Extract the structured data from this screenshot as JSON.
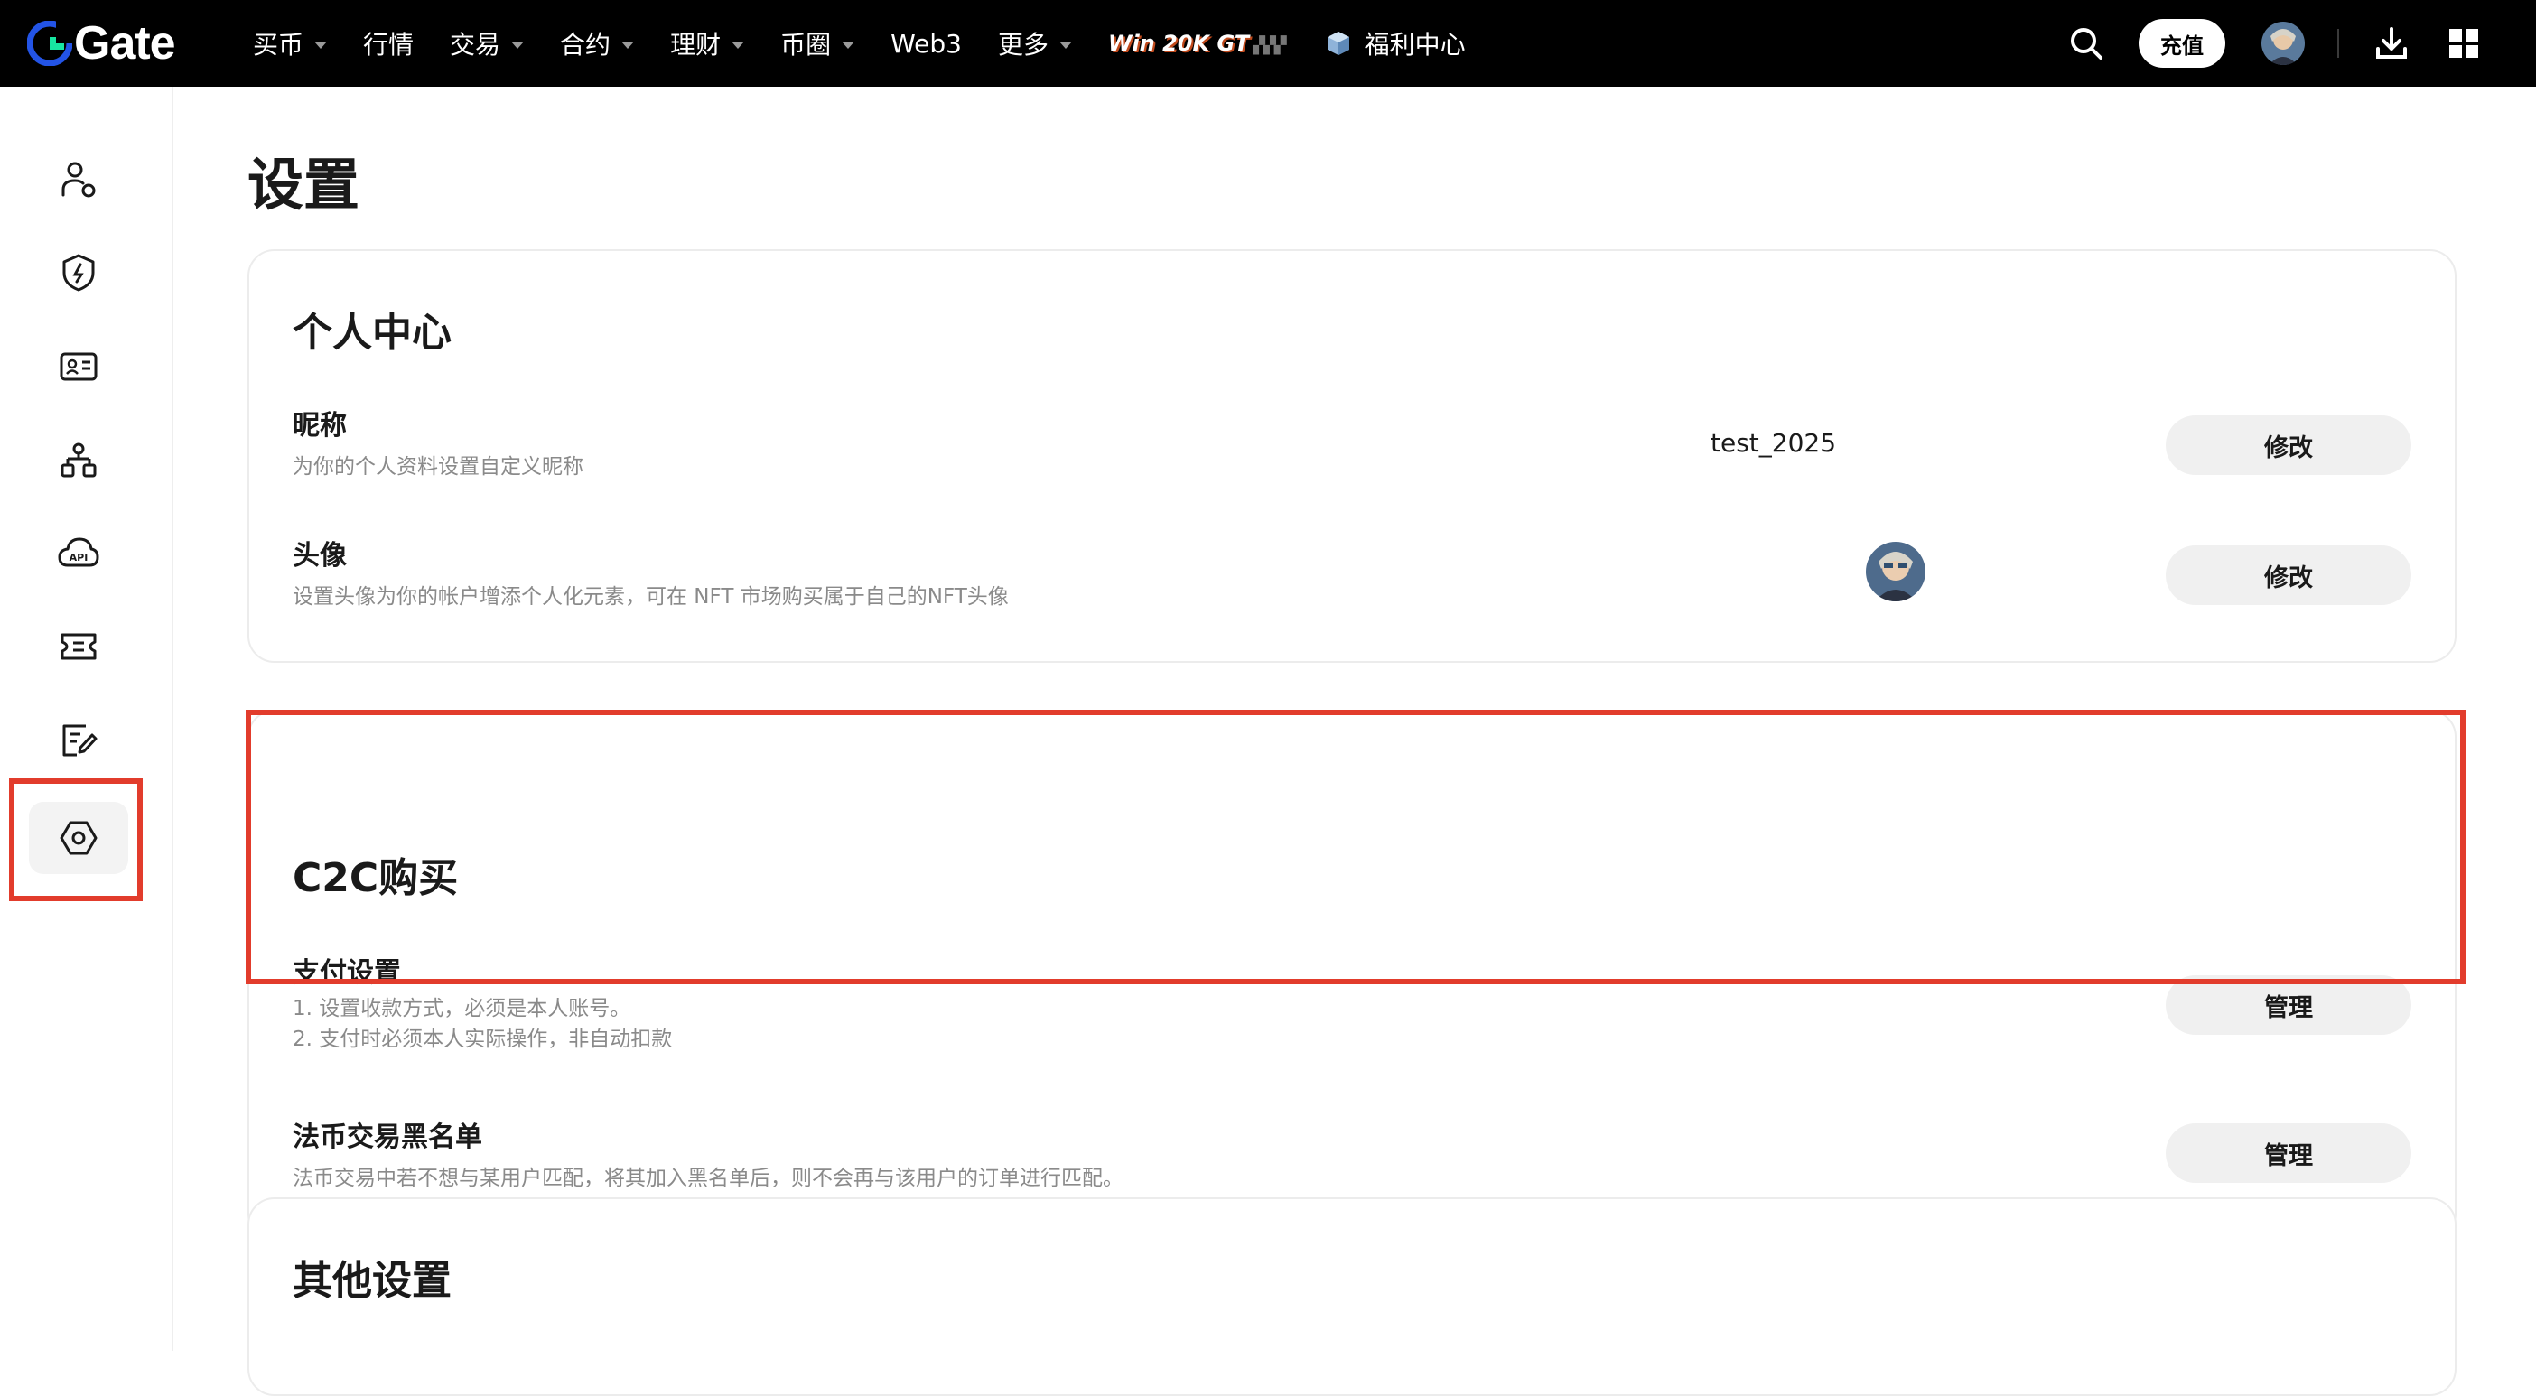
{
  "brand": {
    "name": "Gate"
  },
  "nav": {
    "items": [
      {
        "label": "买币",
        "dropdown": true
      },
      {
        "label": "行情",
        "dropdown": false
      },
      {
        "label": "交易",
        "dropdown": true
      },
      {
        "label": "合约",
        "dropdown": true
      },
      {
        "label": "理财",
        "dropdown": true
      },
      {
        "label": "币圈",
        "dropdown": true
      },
      {
        "label": "Web3",
        "dropdown": false
      },
      {
        "label": "更多",
        "dropdown": true
      }
    ],
    "promo": "Win 20K GT",
    "welfare": "福利中心"
  },
  "topRight": {
    "recharge": "充值"
  },
  "sidebar": {
    "items": [
      "user-profile-icon",
      "security-shield-icon",
      "id-card-icon",
      "sub-account-icon",
      "api-cloud-icon",
      "coupon-ticket-icon",
      "edit-note-icon",
      "settings-hexagon-icon"
    ],
    "activeIndex": 7
  },
  "page": {
    "title": "设置"
  },
  "personal": {
    "title": "个人中心",
    "nickname": {
      "title": "昵称",
      "desc": "为你的个人资料设置自定义昵称",
      "value": "test_2025",
      "button": "修改"
    },
    "avatar": {
      "title": "头像",
      "desc": "设置头像为你的帐户增添个人化元素，可在 NFT 市场购买属于自己的NFT头像",
      "button": "修改"
    }
  },
  "c2c": {
    "title": "C2C购买",
    "payment": {
      "title": "支付设置",
      "desc1": "1. 设置收款方式，必须是本人账号。",
      "desc2": "2. 支付时必须本人实际操作，非自动扣款",
      "button": "管理"
    },
    "blacklist": {
      "title": "法币交易黑名单",
      "desc": "法币交易中若不想与某用户匹配，将其加入黑名单后，则不会再与该用户的订单进行匹配。",
      "button": "管理"
    }
  },
  "other": {
    "title": "其他设置"
  },
  "colors": {
    "accent": "#e23c2c",
    "topbar": "#000000",
    "button": "#f0f0f0"
  }
}
